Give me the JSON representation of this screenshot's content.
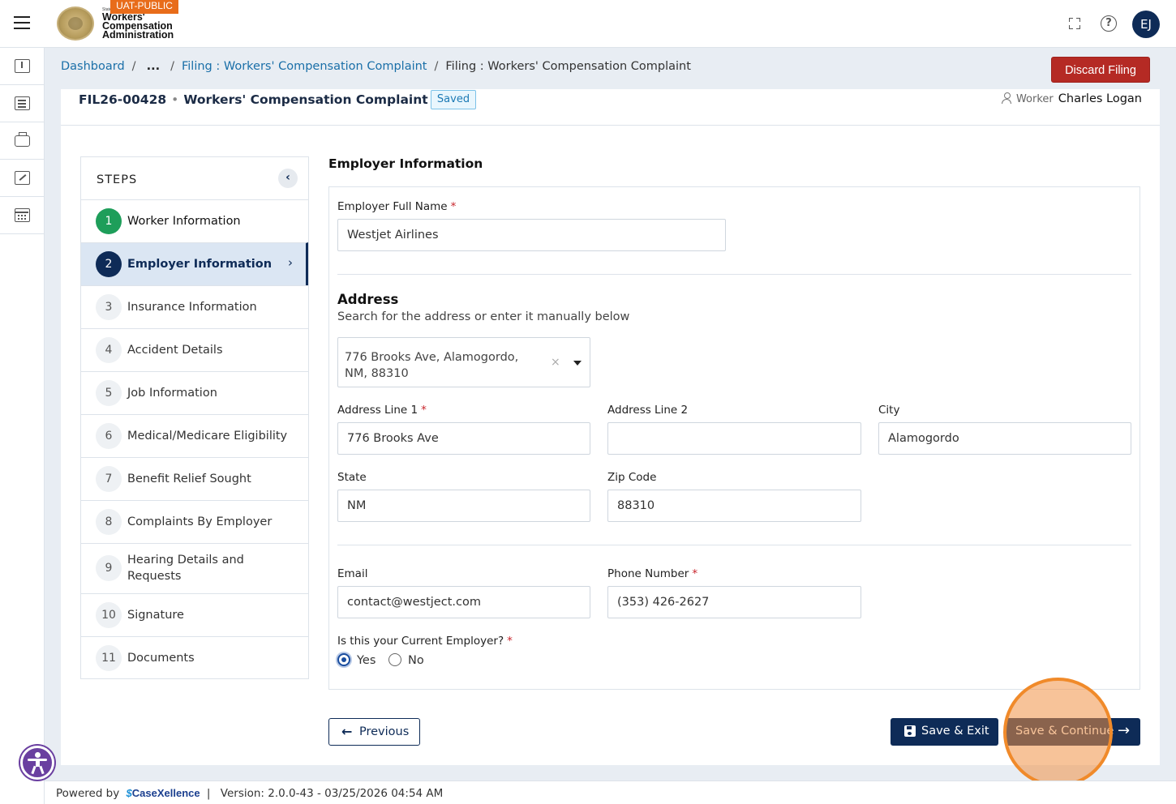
{
  "header": {
    "env_badge": "UAT-PUBLIC",
    "logo_state": "State",
    "logo_line1": "Workers'",
    "logo_line2": "Compensation",
    "logo_line3": "Administration",
    "help_icon": "?",
    "avatar_initials": "EJ"
  },
  "leftrail": {
    "items": [
      "upload-icon",
      "list-icon",
      "briefcase-icon",
      "edit-icon",
      "calendar-icon"
    ]
  },
  "breadcrumb": {
    "items": [
      "Dashboard",
      "...",
      "Filing : Workers' Compensation Complaint",
      "Filing : Workers' Compensation Complaint"
    ],
    "separator": "/"
  },
  "discard_button": "Discard Filing",
  "filing": {
    "id": "FIL26-00428",
    "dot": "•",
    "title": "Workers' Compensation Complaint",
    "status": "Saved",
    "worker_label": "Worker",
    "worker_name": "Charles Logan"
  },
  "steps": {
    "title": "STEPS",
    "collapse_icon": "‹",
    "items": [
      {
        "num": "1",
        "label": "Worker Information",
        "state": "done"
      },
      {
        "num": "2",
        "label": "Employer Information",
        "state": "active"
      },
      {
        "num": "3",
        "label": "Insurance Information",
        "state": "pending"
      },
      {
        "num": "4",
        "label": "Accident Details",
        "state": "pending"
      },
      {
        "num": "5",
        "label": "Job Information",
        "state": "pending"
      },
      {
        "num": "6",
        "label": "Medical/Medicare Eligibility",
        "state": "pending"
      },
      {
        "num": "7",
        "label": "Benefit Relief Sought",
        "state": "pending"
      },
      {
        "num": "8",
        "label": "Complaints By Employer",
        "state": "pending"
      },
      {
        "num": "9",
        "label": "Hearing Details and Requests",
        "state": "pending"
      },
      {
        "num": "10",
        "label": "Signature",
        "state": "pending"
      },
      {
        "num": "11",
        "label": "Documents",
        "state": "pending"
      }
    ],
    "active_chevron": "›"
  },
  "form": {
    "section_title": "Employer Information",
    "required_mark": "*",
    "employer_name_label": "Employer Full Name",
    "employer_name_value": "Westjet Airlines",
    "address_title": "Address",
    "address_subtitle": "Search for the address or enter it manually below",
    "address_search_value": "776 Brooks Ave, Alamogordo, NM, 88310",
    "address_clear": "×",
    "address_line1_label": "Address Line 1",
    "address_line1_value": "776 Brooks Ave",
    "address_line2_label": "Address Line 2",
    "address_line2_value": "",
    "city_label": "City",
    "city_value": "Alamogordo",
    "state_label": "State",
    "state_value": "NM",
    "zip_label": "Zip Code",
    "zip_value": "88310",
    "email_label": "Email",
    "email_value": "contact@westject.com",
    "phone_label": "Phone Number",
    "phone_value": "(353) 426-2627",
    "current_employer_label": "Is this your Current Employer?",
    "current_employer_options": [
      "Yes",
      "No"
    ],
    "current_employer_selected": "Yes"
  },
  "actions": {
    "previous": "Previous",
    "previous_arrow": "←",
    "save_exit": "Save & Exit",
    "save_continue": "Save & Continue",
    "continue_arrow": "→"
  },
  "footer": {
    "powered_by": "Powered by",
    "brand_mark": "$",
    "brand_name": "CaseXellence",
    "divider": "|",
    "version": "Version: 2.0.0-43 - 03/25/2026 04:54 AM"
  },
  "colors": {
    "primary": "#0e2b57",
    "danger": "#b52a24",
    "success": "#1e9e5a",
    "link": "#1a6fa8",
    "env_badge": "#e86c1a"
  }
}
